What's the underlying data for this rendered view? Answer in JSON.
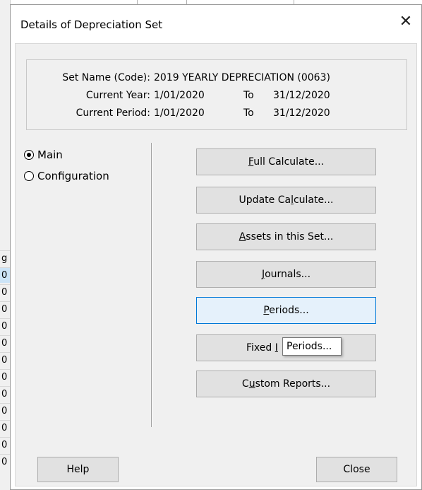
{
  "dialog": {
    "title": "Details of Depreciation Set",
    "close_glyph": "✕"
  },
  "info": {
    "set_name_label": "Set Name (Code):",
    "set_name_value": "2019 YEARLY DEPRECIATION (0063)",
    "current_year_label": "Current Year:",
    "current_year_start": "1/01/2020",
    "current_year_to": "To",
    "current_year_end": "31/12/2020",
    "current_period_label": "Current Period:",
    "current_period_start": "1/01/2020",
    "current_period_to": "To",
    "current_period_end": "31/12/2020"
  },
  "radios": [
    {
      "label": "Main",
      "selected": true
    },
    {
      "label": "Configuration",
      "selected": false
    }
  ],
  "buttons": {
    "full_calculate": {
      "pre": "",
      "ul": "F",
      "post": "ull Calculate..."
    },
    "update_calculate": {
      "pre": "Update Ca",
      "ul": "l",
      "post": "culate..."
    },
    "assets_in_set": {
      "pre": "",
      "ul": "A",
      "post": "ssets in this Set..."
    },
    "journals": {
      "pre": "",
      "ul": "J",
      "post": "ournals..."
    },
    "periods": {
      "pre": "",
      "ul": "P",
      "post": "eriods..."
    },
    "fixed": {
      "pre": "Fixed ",
      "ul": "I",
      "post": ""
    },
    "custom_reports": {
      "pre": "C",
      "ul": "u",
      "post": "stom Reports..."
    }
  },
  "tooltip": {
    "text": "Periods..."
  },
  "footer": {
    "help_label": "Help",
    "close_label": "Close"
  },
  "background": {
    "strip_cells": [
      "g",
      "0",
      "0",
      "0",
      "0",
      "0",
      "0",
      "0",
      "0",
      "0",
      "0",
      "0",
      "0"
    ]
  }
}
